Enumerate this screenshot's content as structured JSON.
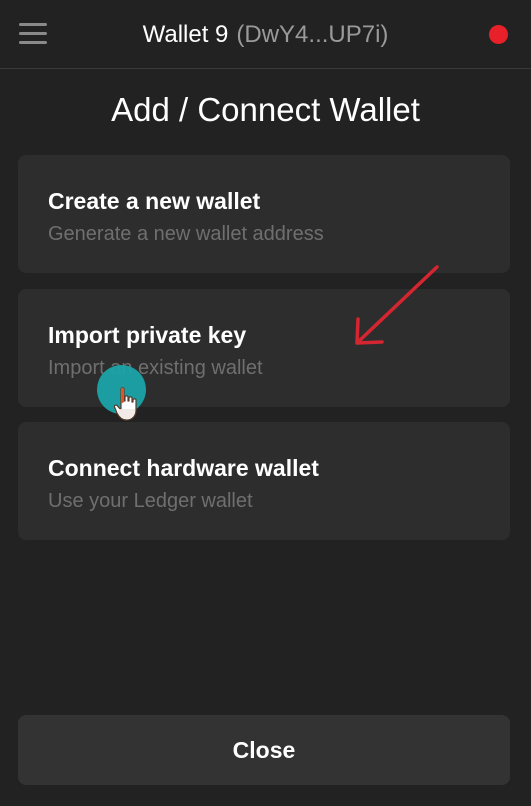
{
  "header": {
    "menu_icon": "hamburger-menu-icon",
    "wallet_name": "Wallet 9",
    "wallet_address": "(DwY4...UP7i)",
    "status_color": "#e8202a"
  },
  "page": {
    "title": "Add / Connect Wallet"
  },
  "options": [
    {
      "title": "Create a new wallet",
      "subtitle": "Generate a new wallet address"
    },
    {
      "title": "Import private key",
      "subtitle": "Import an existing wallet"
    },
    {
      "title": "Connect hardware wallet",
      "subtitle": "Use your Ledger wallet"
    }
  ],
  "footer": {
    "close_label": "Close"
  },
  "annotations": {
    "arrow_color": "#d32630",
    "cursor_highlight_color": "#1aa3a8"
  }
}
